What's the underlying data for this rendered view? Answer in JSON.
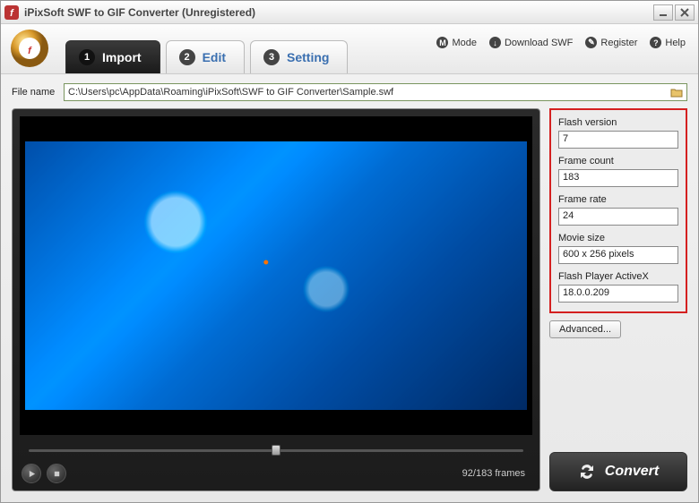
{
  "window": {
    "title": "iPixSoft SWF to GIF Converter (Unregistered)"
  },
  "toplinks": {
    "mode": {
      "icon": "M",
      "label": "Mode"
    },
    "download": {
      "icon": "↓",
      "label": "Download SWF"
    },
    "register": {
      "icon": "✎",
      "label": "Register"
    },
    "help": {
      "icon": "?",
      "label": "Help"
    }
  },
  "tabs": [
    {
      "num": "1",
      "label": "Import",
      "active": true
    },
    {
      "num": "2",
      "label": "Edit",
      "active": false
    },
    {
      "num": "3",
      "label": "Setting",
      "active": false
    }
  ],
  "file": {
    "label": "File name",
    "path": "C:\\Users\\pc\\AppData\\Roaming\\iPixSoft\\SWF to GIF Converter\\Sample.swf"
  },
  "preview": {
    "current_frame": 92,
    "total_frames": 183,
    "frames_text": "92/183 frames",
    "progress_pct": 50
  },
  "info": {
    "flash_version": {
      "label": "Flash version",
      "value": "7"
    },
    "frame_count": {
      "label": "Frame count",
      "value": "183"
    },
    "frame_rate": {
      "label": "Frame rate",
      "value": "24"
    },
    "movie_size": {
      "label": "Movie size",
      "value": "600 x 256 pixels"
    },
    "activex": {
      "label": "Flash Player ActiveX",
      "value": "18.0.0.209"
    }
  },
  "buttons": {
    "advanced": "Advanced...",
    "convert": "Convert"
  }
}
